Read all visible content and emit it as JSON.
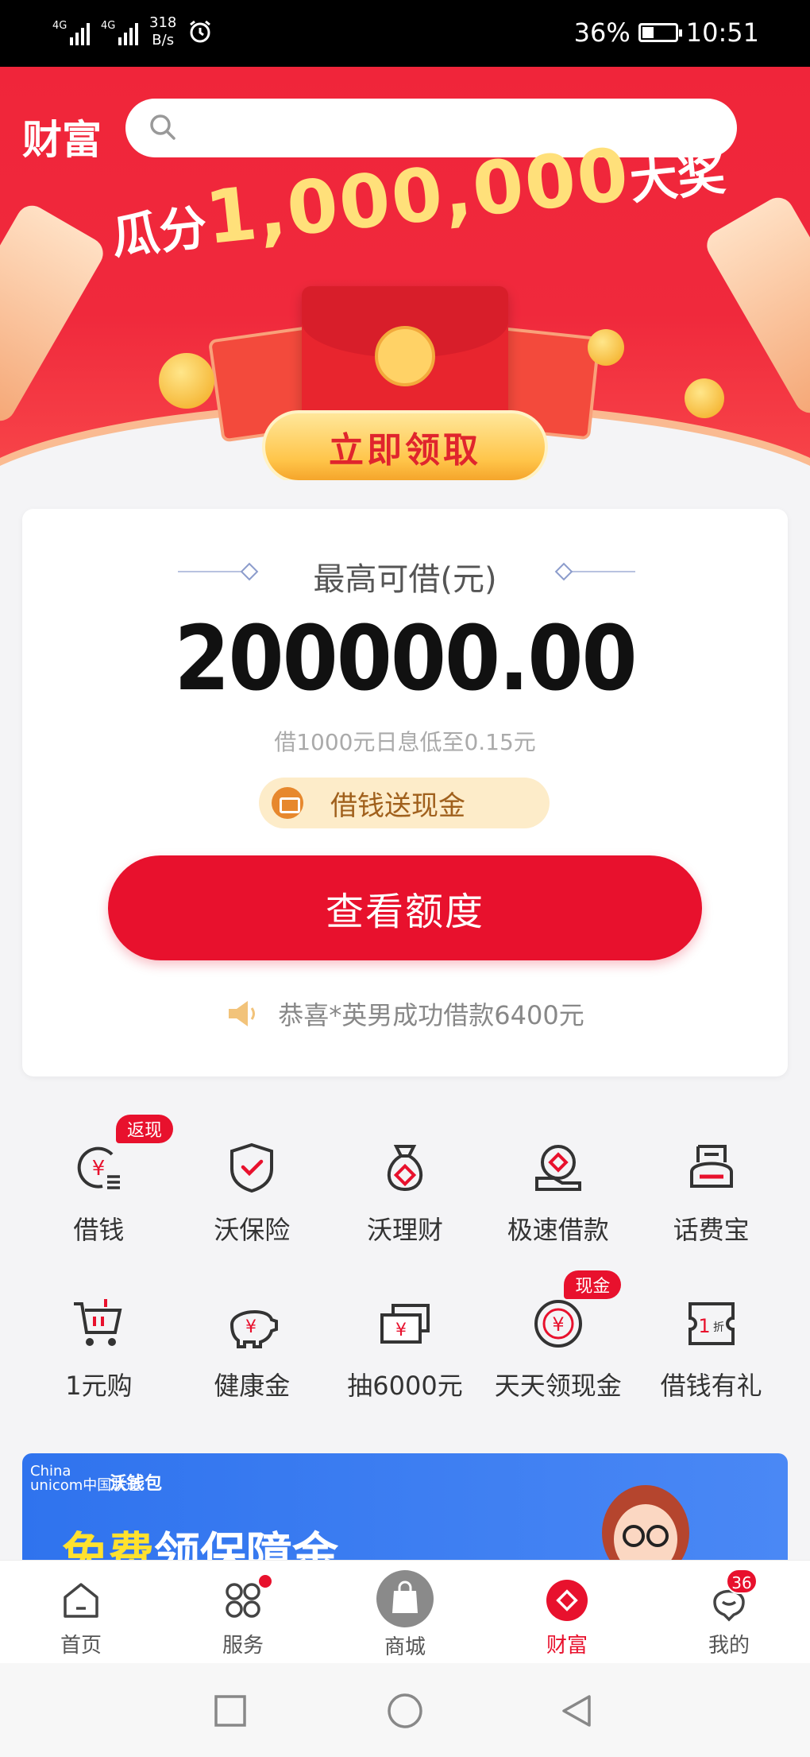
{
  "status_bar": {
    "network1": "4G",
    "network2": "4G",
    "speed_value": "318",
    "speed_unit": "B/s",
    "battery": "36%",
    "time": "10:51",
    "alarm_icon": "alarm-icon"
  },
  "header": {
    "title": "财富",
    "search_placeholder": ""
  },
  "banner": {
    "headline_pre": "瓜分",
    "headline_number": "1,000,000",
    "headline_post": "大奖",
    "cta": "立即领取"
  },
  "loan_card": {
    "title": "最高可借(元)",
    "amount": "200000.00",
    "rate_text": "借1000元日息低至0.15元",
    "promo": "借钱送现金",
    "button": "查看额度",
    "notice": "恭喜*英男成功借款6400元"
  },
  "services": {
    "row1": [
      {
        "label": "借钱",
        "icon": "loan-yen-icon",
        "badge": "返现"
      },
      {
        "label": "沃保险",
        "icon": "shield-check-icon",
        "badge": ""
      },
      {
        "label": "沃理财",
        "icon": "money-bag-icon",
        "badge": ""
      },
      {
        "label": "极速借款",
        "icon": "fast-loan-icon",
        "badge": ""
      },
      {
        "label": "话费宝",
        "icon": "phone-bill-icon",
        "badge": ""
      }
    ],
    "row2": [
      {
        "label": "1元购",
        "icon": "cart-icon",
        "badge": ""
      },
      {
        "label": "健康金",
        "icon": "piggy-bank-icon",
        "badge": ""
      },
      {
        "label": "抽6000元",
        "icon": "cash-stack-icon",
        "badge": ""
      },
      {
        "label": "天天领现金",
        "icon": "yen-coin-icon",
        "badge": "现金"
      },
      {
        "label": "借钱有礼",
        "icon": "discount-coupon-icon",
        "badge": ""
      }
    ]
  },
  "promo_banner": {
    "logo_line1": "China",
    "logo_line2": "unicom中国联通",
    "brand": "沃钱包",
    "text_highlight": "免费",
    "text_rest": "领保障金"
  },
  "tab_bar": {
    "tabs": [
      {
        "label": "首页",
        "icon": "home-icon"
      },
      {
        "label": "服务",
        "icon": "services-grid-icon"
      },
      {
        "label": "商城",
        "icon": "shopping-bag-icon"
      },
      {
        "label": "财富",
        "icon": "wealth-diamond-icon"
      },
      {
        "label": "我的",
        "icon": "profile-icon"
      }
    ],
    "active": "财富",
    "my_count": "36"
  },
  "colors": {
    "primary_red": "#e8112d",
    "banner_red": "#f0253a",
    "gold": "#ffc54a"
  }
}
